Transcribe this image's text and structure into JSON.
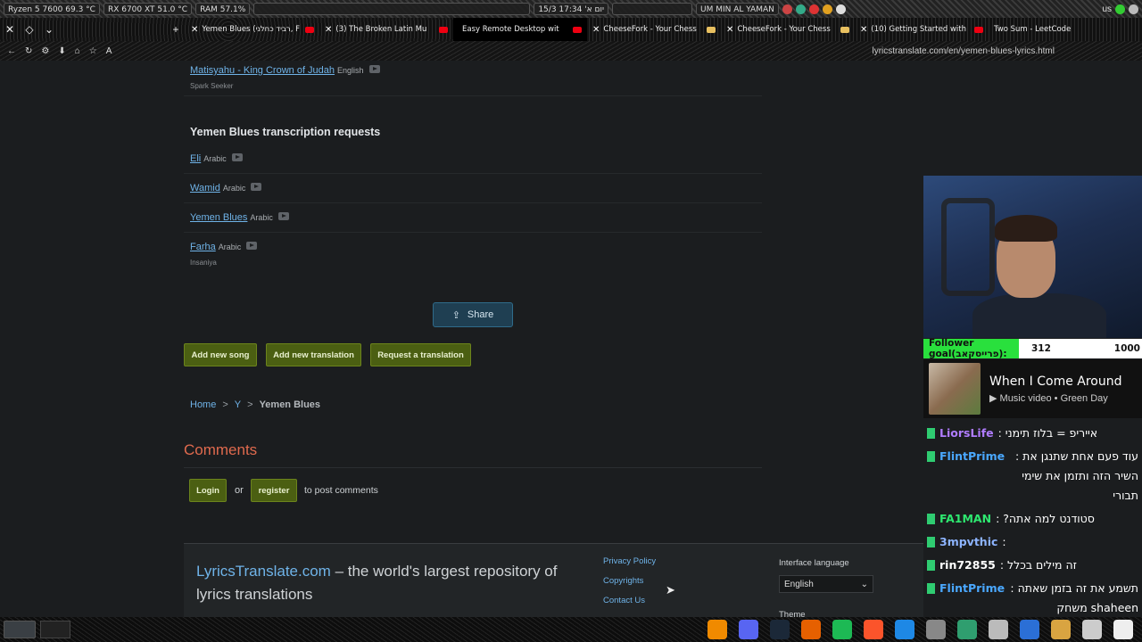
{
  "sysbar": {
    "cpu": "Ryzen 5 7600  69.3 °C",
    "gpu": "RX 6700 XT  51.0 °C",
    "ram": "RAM  57.1%",
    "datetime": "15/3 יום א' 17:34",
    "now_playing": "UM MIN AL YAMAN",
    "locale": "us"
  },
  "tabs": [
    {
      "title": "Yemen Blues (רביד כחלני, F",
      "active": false
    },
    {
      "title": "(3) The Broken Latin Mu",
      "active": false
    },
    {
      "title": "Easy Remote Desktop wit",
      "active": true
    },
    {
      "title": "CheeseFork - Your Chess",
      "active": false
    },
    {
      "title": "CheeseFork - Your Chess",
      "active": false
    },
    {
      "title": "(10) Getting Started with",
      "active": false
    },
    {
      "title": "Two Sum - LeetCode",
      "active": false
    }
  ],
  "url": "lyricstranslate.com/en/yemen-blues-lyrics.html",
  "page": {
    "top_item": {
      "title": "Matisyahu - King Crown of Judah",
      "lang": "English",
      "sub": "Spark Seeker"
    },
    "requests_title": "Yemen Blues transcription requests",
    "requests": [
      {
        "title": "Eli",
        "lang": "Arabic",
        "sub": ""
      },
      {
        "title": "Wamid",
        "lang": "Arabic",
        "sub": ""
      },
      {
        "title": "Yemen Blues",
        "lang": "Arabic",
        "sub": ""
      },
      {
        "title": "Farha",
        "lang": "Arabic",
        "sub": "Insaniya"
      }
    ],
    "share_label": "Share",
    "buttons": {
      "add_song": "Add new song",
      "add_translation": "Add new translation",
      "request_translation": "Request a translation"
    },
    "breadcrumb": {
      "home": "Home",
      "letter": "Y",
      "current": "Yemen Blues"
    },
    "comments": {
      "title": "Comments",
      "login": "Login",
      "or": "or",
      "register": "register",
      "suffix": "to post comments"
    },
    "footer": {
      "brand": "LyricsTranslate.com",
      "tagline": " – the world's largest repository of lyrics translations",
      "links": [
        "Privacy Policy",
        "Copyrights",
        "Contact Us"
      ],
      "interface_language_label": "Interface language",
      "interface_language_value": "English",
      "theme_label": "Theme"
    }
  },
  "stream": {
    "goal_label": "Follower goal(פרייסקאב):",
    "goal_current": "312",
    "goal_max": "1000",
    "goal_fraction": 0.312,
    "song_title": "When I Come Around",
    "song_sub": "Music video • Green Day",
    "chat": [
      {
        "nick": "LiorsLife",
        "color": "#b07cff",
        "text": "אייריפ = בלוז תימני :"
      },
      {
        "nick": "FlintPrime",
        "color": "#4aa8ff",
        "text": "עוד פעם אחת שתנגן את : השיר הזה ותזמן את שימי תבורי"
      },
      {
        "nick": "FA1MAN",
        "color": "#2ee870",
        "text": "סטודנט למה אתה? :"
      },
      {
        "nick": "3mpvthic",
        "color": "#8db4ff",
        "text": ":"
      },
      {
        "nick": "rin72855",
        "color": "#ffffff",
        "text": "זה מילים בכלל :"
      },
      {
        "nick": "FlintPrime",
        "color": "#4aa8ff",
        "text": "תשמע את זה בזמן שאתה : shaheen משחק"
      }
    ]
  }
}
